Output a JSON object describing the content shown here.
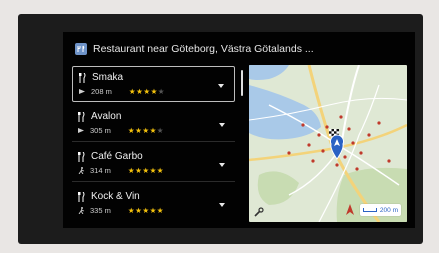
{
  "header": {
    "title": "Restaurant near Göteborg, Västra Götalands ..."
  },
  "results": [
    {
      "name": "Smaka",
      "distance": "208 m",
      "rating": 4,
      "max_rating": 5
    },
    {
      "name": "Avalon",
      "distance": "305 m",
      "rating": 4,
      "max_rating": 5
    },
    {
      "name": "Café Garbo",
      "distance": "314 m",
      "rating": 5,
      "max_rating": 5
    },
    {
      "name": "Kock & Vin",
      "distance": "335 m",
      "rating": 5,
      "max_rating": 5
    }
  ],
  "selected_index": 0,
  "map": {
    "scale_label": "200 m"
  },
  "colors": {
    "star": "#f4c20d",
    "map_water": "#a9c9e8",
    "map_land": "#dfe8d4",
    "map_park": "#c8dcb2",
    "poi": "#c0392b",
    "position_marker": "#2a62c4"
  }
}
